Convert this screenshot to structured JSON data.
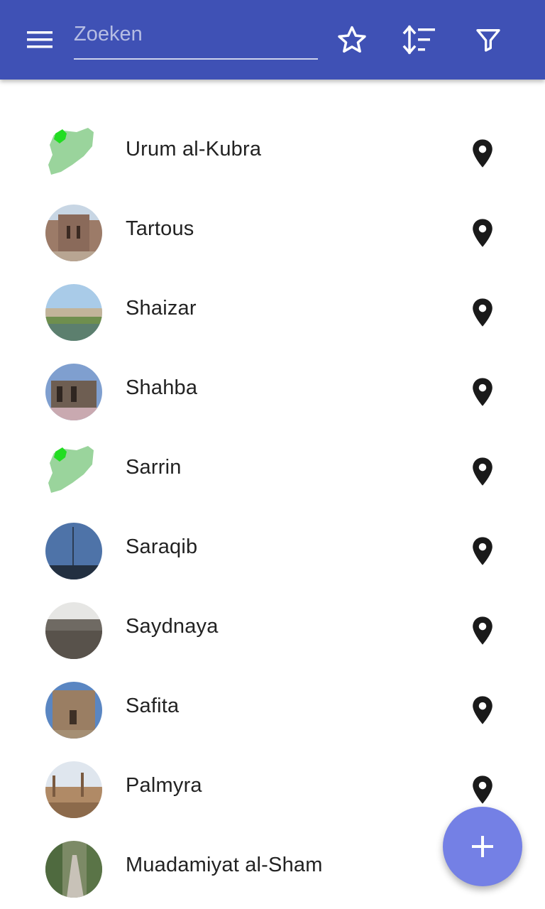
{
  "toolbar": {
    "background_color": "#3f51b5",
    "menu_icon": "hamburger-menu-icon",
    "search_placeholder": "Zoeken",
    "search_value": "",
    "favorite_icon": "star-outline-icon",
    "sort_icon": "sort-icon",
    "filter_icon": "filter-icon"
  },
  "places": [
    {
      "name": "Urum al-Kubra",
      "thumbnail": "syria-map"
    },
    {
      "name": "Tartous",
      "thumbnail": "photo"
    },
    {
      "name": "Shaizar",
      "thumbnail": "photo"
    },
    {
      "name": "Shahba",
      "thumbnail": "photo"
    },
    {
      "name": "Sarrin",
      "thumbnail": "syria-map"
    },
    {
      "name": "Saraqib",
      "thumbnail": "photo"
    },
    {
      "name": "Saydnaya",
      "thumbnail": "photo"
    },
    {
      "name": "Safita",
      "thumbnail": "photo"
    },
    {
      "name": "Palmyra",
      "thumbnail": "photo"
    },
    {
      "name": "Muadamiyat al-Sham",
      "thumbnail": "photo"
    }
  ],
  "row_action_icon": "map-marker-icon",
  "fab": {
    "icon": "plus-icon",
    "color": "#7480e5"
  }
}
